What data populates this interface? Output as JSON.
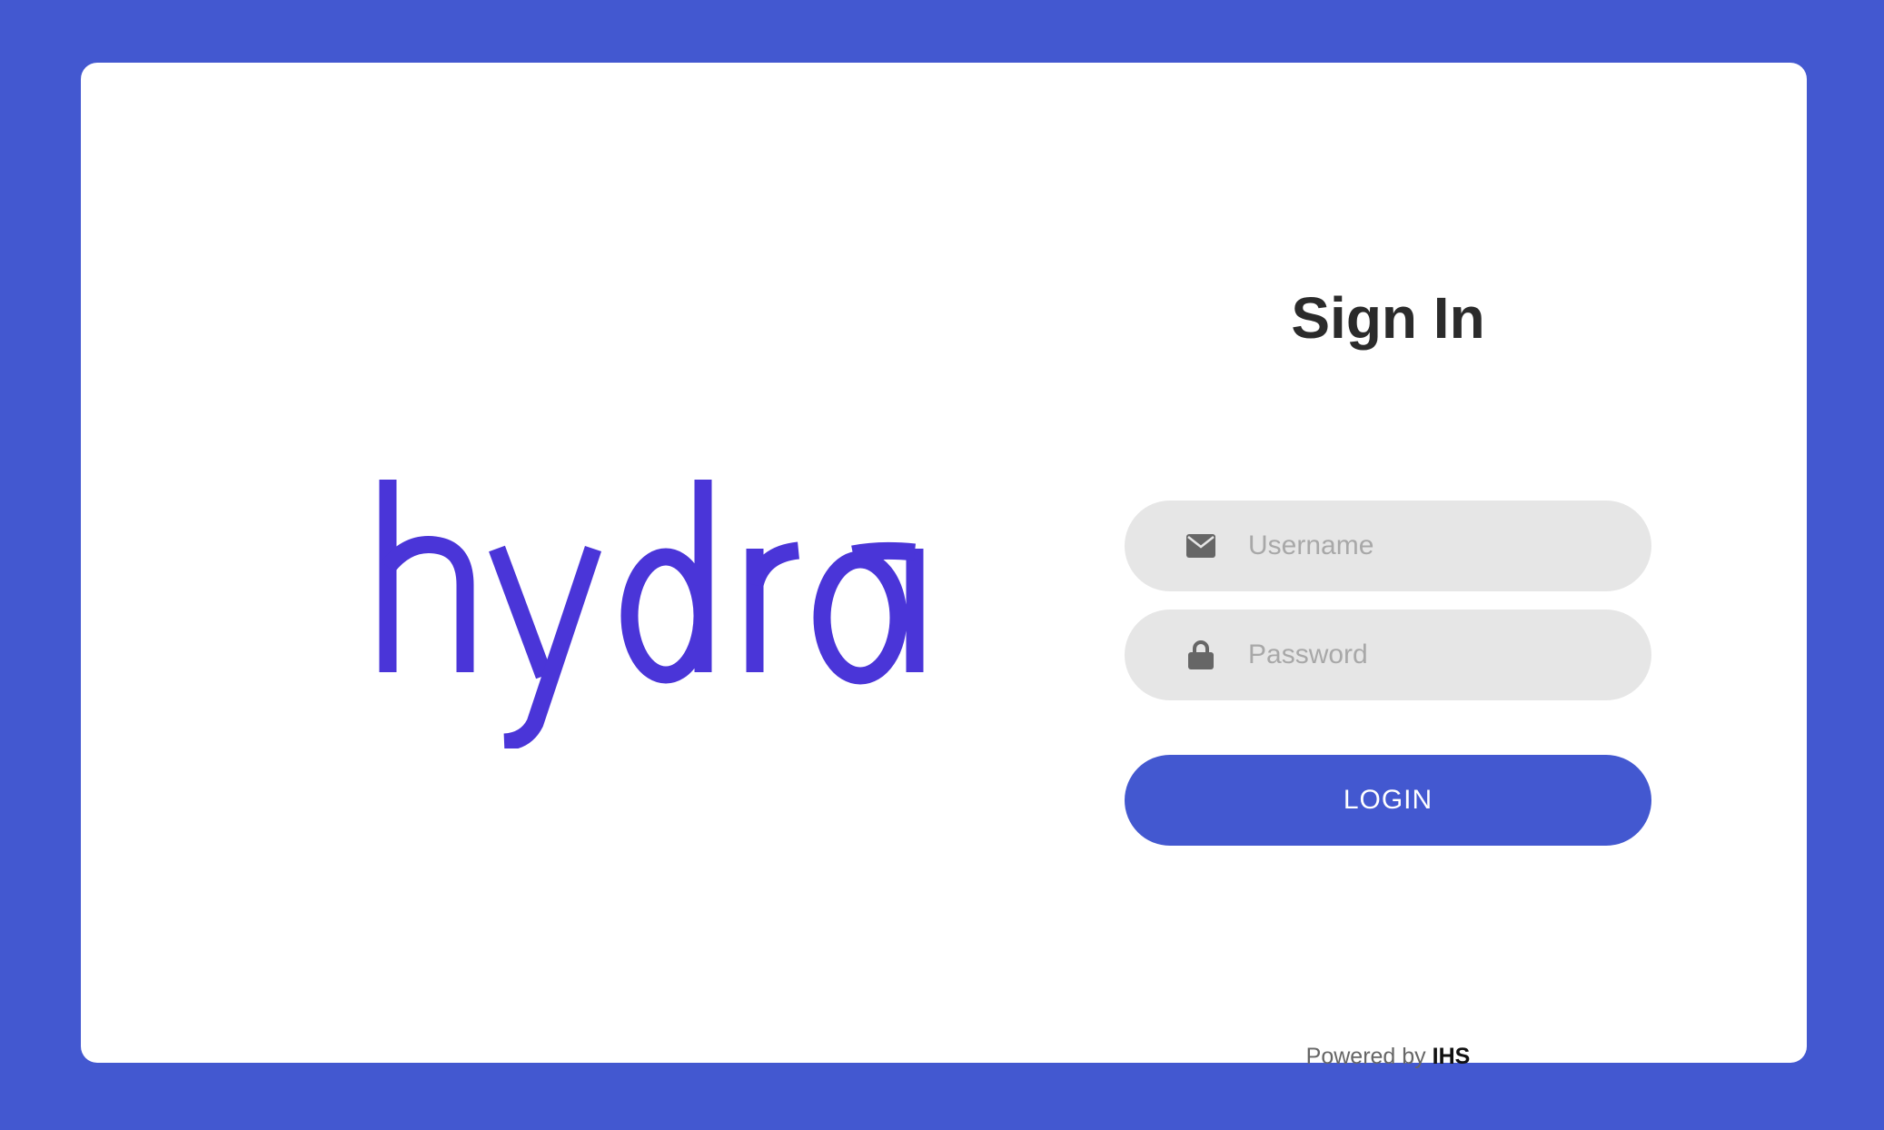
{
  "colors": {
    "background": "#4358d0",
    "card": "#ffffff",
    "logo": "#4a35d8",
    "field_bg": "#e6e6e6",
    "button": "#4358d0"
  },
  "logo": {
    "text": "hydra"
  },
  "form": {
    "title": "Sign In",
    "username": {
      "placeholder": "Username",
      "value": "",
      "icon": "envelope-icon"
    },
    "password": {
      "placeholder": "Password",
      "value": "",
      "icon": "lock-icon"
    },
    "login_label": "LOGIN"
  },
  "footer": {
    "prefix": "Powered by",
    "brand": "IHS"
  }
}
